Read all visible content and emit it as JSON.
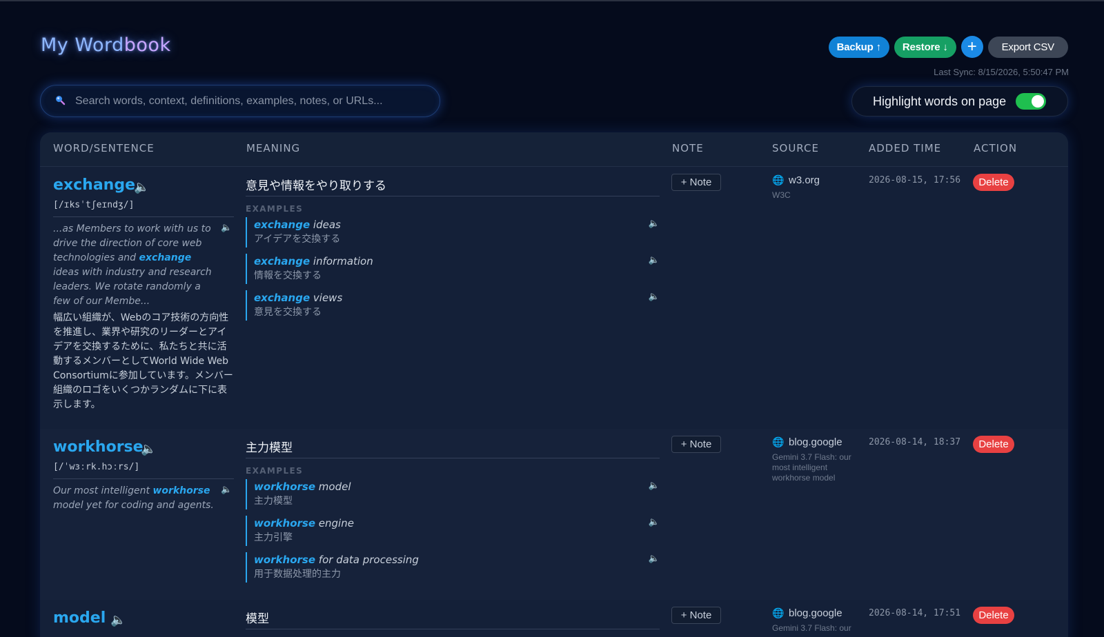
{
  "header": {
    "title_main": "My Word",
    "title_accent": "book",
    "backup_label": "Backup ↑",
    "restore_label": "Restore ↓",
    "add_label": "+",
    "export_label": "Export CSV",
    "last_sync": "Last Sync: 8/15/2026, 5:50:47 PM"
  },
  "search": {
    "placeholder": "Search words, context, definitions, examples, notes, or URLs..."
  },
  "highlight": {
    "label": "Highlight words on page",
    "enabled": true
  },
  "colors": {
    "accent": "#2aa7ef",
    "delete": "#e84142",
    "toggle_on": "#1fbf4f",
    "background": "#050b1c"
  },
  "table": {
    "columns": [
      "WORD/SENTENCE",
      "MEANING",
      "NOTE",
      "SOURCE",
      "ADDED TIME",
      "ACTION"
    ],
    "examples_label": "EXAMPLES",
    "note_label": "+ Note",
    "delete_label": "Delete",
    "rows": [
      {
        "word": "exchange",
        "ipa": "[/ɪksˈtʃeɪndʒ/]",
        "context_pre": "...as Members to work with us to drive the direction of core web technologies and ",
        "context_word": "exchange",
        "context_post": " ideas with industry and research leaders. We rotate randomly a few of our Membe...",
        "translation": "幅広い組織が、Webのコア技術の方向性を推進し、業界や研究のリーダーとアイデアを交換するために、私たちと共に活動するメンバーとしてWorld Wide Web Consortiumに参加しています。メンバー組織のロゴをいくつかランダムに下に表示します。",
        "meaning": "意見や情報をやり取りする",
        "examples": [
          {
            "word": "exchange",
            "rest": " ideas",
            "ja": "アイデアを交換する"
          },
          {
            "word": "exchange",
            "rest": " information",
            "ja": "情報を交換する"
          },
          {
            "word": "exchange",
            "rest": " views",
            "ja": "意見を交換する"
          }
        ],
        "source_site": "w3.org",
        "source_title": "W3C",
        "added": "2026-08-15, 17:56"
      },
      {
        "word": "workhorse",
        "ipa": "[/ˈwɜːrk.hɔːrs/]",
        "context_pre": "Our most intelligent ",
        "context_word": "workhorse",
        "context_post": " model yet for coding and agents.",
        "meaning": "主力模型",
        "examples": [
          {
            "word": "workhorse",
            "rest": " model",
            "ja": "主力模型"
          },
          {
            "word": "workhorse",
            "rest": " engine",
            "ja": "主力引擎"
          },
          {
            "word": "workhorse",
            "rest": " for data processing",
            "ja": "用于数据处理的主力"
          }
        ],
        "source_site": "blog.google",
        "source_title": "Gemini 3.7 Flash: our most intelligent workhorse model",
        "added": "2026-08-14, 18:37"
      },
      {
        "word": "model",
        "meaning": "模型",
        "source_site": "blog.google",
        "source_title": "Gemini 3.7 Flash: our",
        "added": "2026-08-14, 17:51"
      }
    ]
  }
}
